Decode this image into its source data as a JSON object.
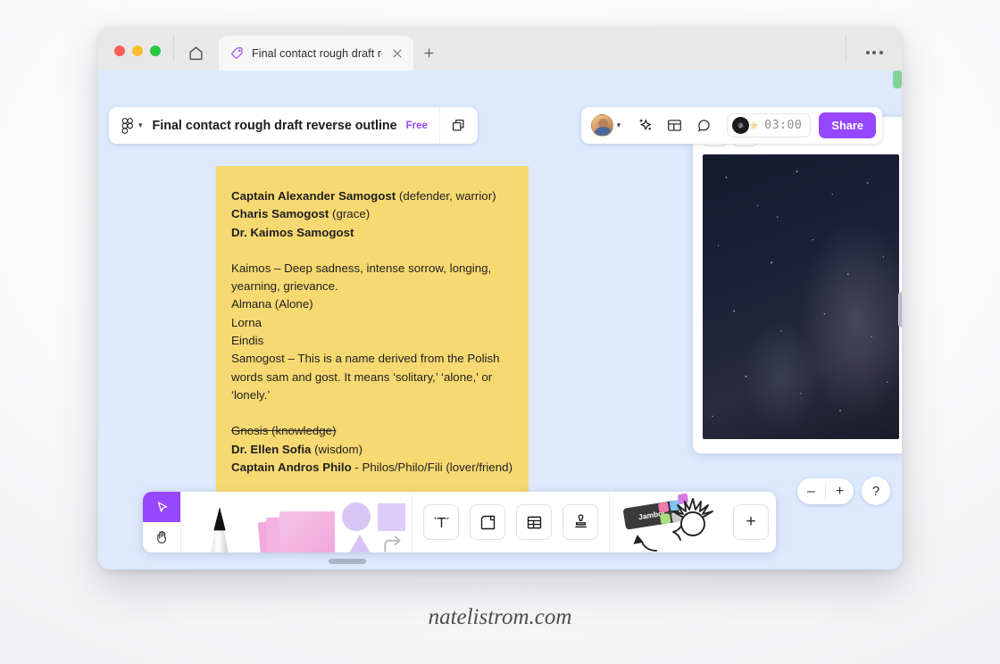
{
  "browser": {
    "home_icon": "home-icon",
    "new_tab_label": "+",
    "overflow_label": "…",
    "tab": {
      "favicon": "tag-icon",
      "title": "Final contact rough draft reverse",
      "close_label": "×"
    }
  },
  "appbar": {
    "logo_icon": "figjam-logo-icon",
    "chevron": "▾",
    "doc_title": "Final contact rough draft reverse outline",
    "plan_badge": "Free",
    "duplicate_icon": "duplicate-icon",
    "avatar_icon": "user-avatar",
    "avatar_chevron": "▾",
    "ai_icon": "sparkle-icon",
    "layout_icon": "layout-panel-icon",
    "comment_icon": "comment-bubble-icon",
    "timer": {
      "music_icon": "vinyl-record-icon",
      "star_icon": "star-sticker-icon",
      "value": "03:00"
    },
    "share_label": "Share"
  },
  "canvas": {
    "background_color": "#ddeafe",
    "sticky_note": {
      "color": "#f7d972",
      "lines": [
        {
          "bold": "Captain Alexander Samogost",
          "rest": " (defender, warrior)"
        },
        {
          "bold": "Charis Samogost",
          "rest": " (grace)"
        },
        {
          "bold": "Dr. Kaimos Samogost",
          "rest": ""
        },
        {
          "bold": "",
          "rest": ""
        },
        {
          "bold": "",
          "rest": "Kaimos – Deep sadness, intense sorrow, longing, yearning, grievance."
        },
        {
          "bold": "",
          "rest": "Almana (Alone)"
        },
        {
          "bold": "",
          "rest": "Lorna"
        },
        {
          "bold": "",
          "rest": "Eindis"
        },
        {
          "bold": "",
          "rest": "Samogost – This is a name derived from the Polish words sam and gost. It means ‘solitary,’ ‘alone,’ or ‘lonely.’"
        },
        {
          "bold": "",
          "rest": ""
        },
        {
          "bold": "",
          "rest": "Gnosis (knowledge)",
          "strike": true
        },
        {
          "bold": "Dr. Ellen Sofia",
          "rest": " (wisdom)"
        },
        {
          "bold": "Captain Andros Philo",
          "rest": " - Philos/Philo/Fili (lover/friend)"
        }
      ],
      "text_line_1_bold": "Captain Alexander Samogost",
      "text_line_1_rest": " (defender, warrior)",
      "text_line_2_bold": "Charis Samogost",
      "text_line_2_rest": " (grace)",
      "text_line_3_bold": "Dr. Kaimos Samogost",
      "text_para_1": "Kaimos – Deep sadness, intense sorrow, longing, yearning, grievance.",
      "text_line_almana": "Almana (Alone)",
      "text_line_lorna": "Lorna",
      "text_line_eindis": "Eindis",
      "text_para_2": "Samogost – This is a name derived from the Polish words sam and gost. It means ‘solitary,’ ‘alone,’ or ‘lonely.’",
      "text_gnosis": "Gnosis (knowledge)",
      "text_sofia_bold": "Dr. Ellen Sofia",
      "text_sofia_rest": " (wisdom)",
      "text_philo_bold": "Captain Andros Philo",
      "text_philo_rest": " - Philos/Philo/Fili (lover/friend)"
    },
    "photo_panel": {
      "like_icon": "heart-icon",
      "add_label": "+",
      "image_alt": "milky-way-night-sky-photo"
    },
    "zoom": {
      "out_label": "–",
      "in_label": "+",
      "help_label": "?"
    }
  },
  "toolbar": {
    "select_icon": "cursor-arrow-icon",
    "hand_icon": "hand-pan-icon",
    "pen_icon": "pen-marker-tool",
    "sticky_icon": "sticky-notes-tool",
    "shapes_icon": "shapes-tool",
    "text_label": "T",
    "text_icon": "text-tool-icon",
    "frame_icon": "frame-tool-icon",
    "table_icon": "table-tool-icon",
    "stamp_icon": "stamp-tool-icon",
    "widget_label": "Jambot",
    "widget_icon": "jambot-widget-icon",
    "more_label": "+"
  },
  "watermark": "natelistrom.com"
}
